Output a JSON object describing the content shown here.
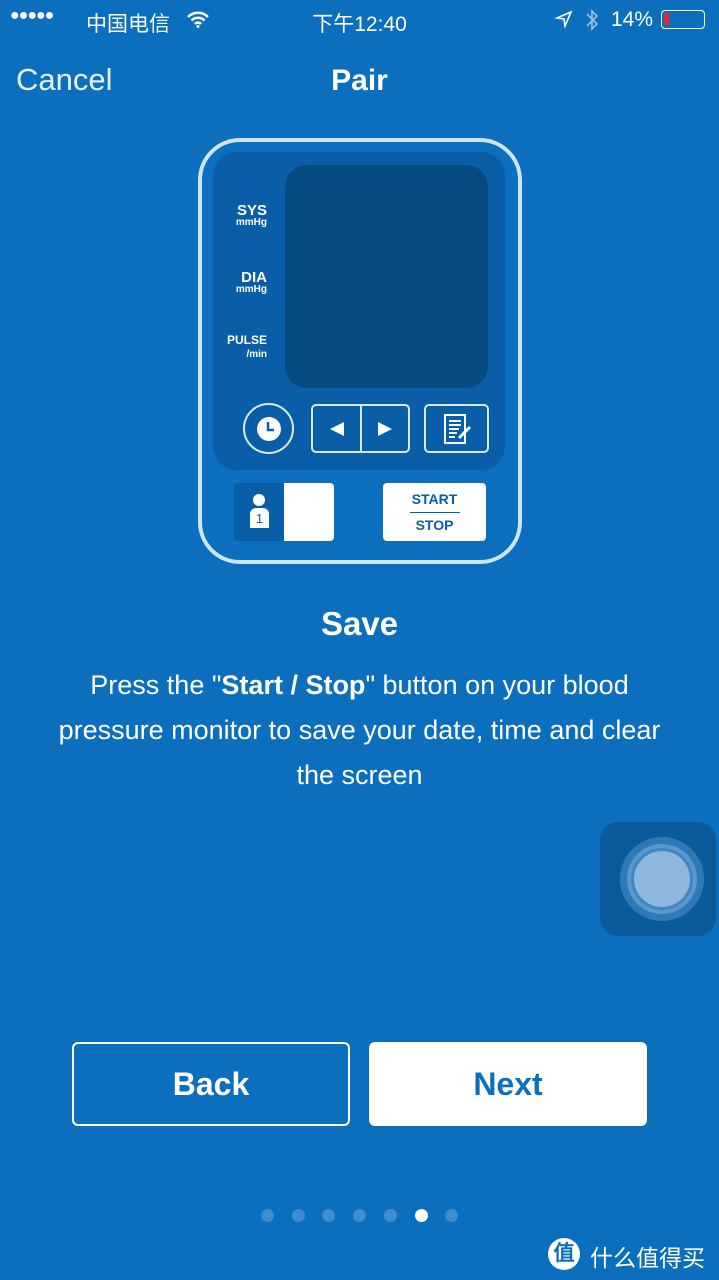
{
  "status_bar": {
    "signal": "●●●●●",
    "carrier": "中国电信",
    "time": "下午12:40",
    "battery": "14%",
    "battery_level": 0.14,
    "battery_color": "#e8252b"
  },
  "nav": {
    "cancel": "Cancel",
    "title": "Pair"
  },
  "device": {
    "sys": "SYS",
    "sys_unit": "mmHg",
    "dia": "DIA",
    "dia_unit": "mmHg",
    "pulse": "PULSE",
    "pulse_unit": "/min",
    "user_number": "1",
    "start": "START",
    "stop": "STOP"
  },
  "step": {
    "title": "Save",
    "desc_pre": "Press the \"",
    "desc_bold": "Start / Stop",
    "desc_post": "\" button on your blood pressure monitor to save your date, time and clear the screen"
  },
  "buttons": {
    "back": "Back",
    "next": "Next"
  },
  "pagination": {
    "total": 7,
    "current": 6
  },
  "watermark": {
    "badge": "值",
    "text": "什么值得买"
  },
  "colors": {
    "background": "#0b6fbd",
    "next_text": "#0b6fbd"
  }
}
